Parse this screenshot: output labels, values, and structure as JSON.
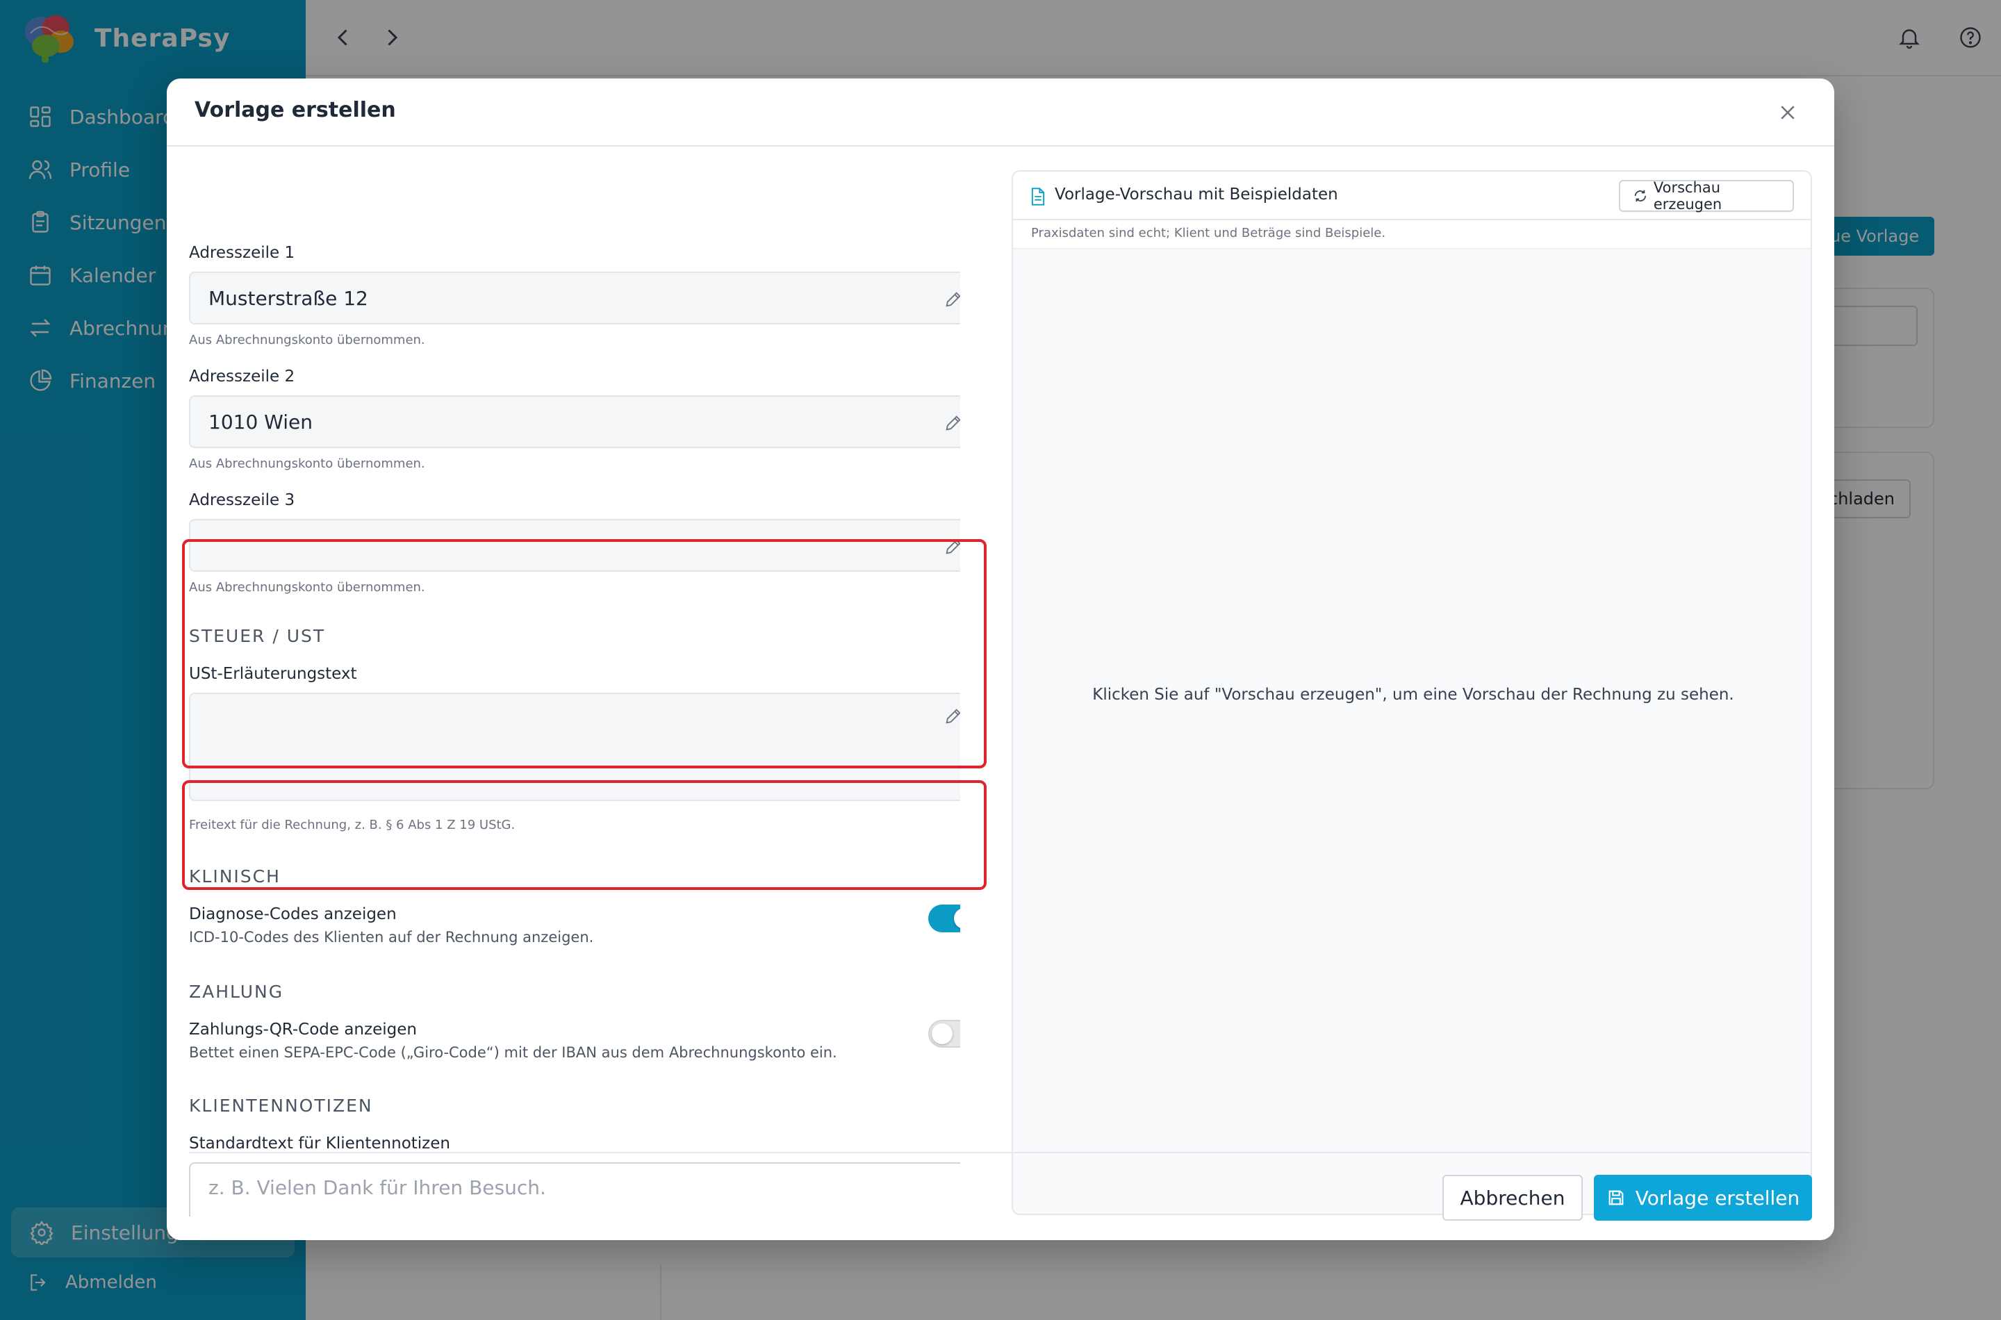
{
  "app": {
    "name": "TheraPsy"
  },
  "sidebar": {
    "items": [
      {
        "label": "Dashboard",
        "icon": "grid-icon"
      },
      {
        "label": "Profile",
        "icon": "users-icon"
      },
      {
        "label": "Sitzungen",
        "icon": "clipboard-icon"
      },
      {
        "label": "Kalender",
        "icon": "calendar-icon"
      },
      {
        "label": "Abrechnung",
        "icon": "swap-icon"
      },
      {
        "label": "Finanzen",
        "icon": "pie-chart-icon"
      }
    ],
    "settings": {
      "label": "Einstellungen",
      "icon": "gear-icon"
    },
    "logout": {
      "label": "Abmelden",
      "icon": "logout-icon"
    }
  },
  "background": {
    "new_template_label": "ue Vorlage",
    "download_label": "chladen"
  },
  "modal": {
    "title": "Vorlage erstellen",
    "fields": {
      "address1": {
        "label": "Adresszeile 1",
        "value": "Musterstraße 12",
        "help": "Aus Abrechnungskonto übernommen."
      },
      "address2": {
        "label": "Adresszeile 2",
        "value": "1010 Wien",
        "help": "Aus Abrechnungskonto übernommen."
      },
      "address3": {
        "label": "Adresszeile 3",
        "value": "",
        "help": "Aus Abrechnungskonto übernommen."
      }
    },
    "tax": {
      "heading": "STEUER / UST",
      "label": "USt-Erläuterungstext",
      "value": "",
      "help": "Freitext für die Rechnung, z. B. § 6 Abs 1 Z 19 UStG."
    },
    "clinical": {
      "heading": "KLINISCH",
      "toggle_title": "Diagnose-Codes anzeigen",
      "toggle_desc": "ICD-10-Codes des Klienten auf der Rechnung anzeigen.",
      "enabled": true
    },
    "payment": {
      "heading": "ZAHLUNG",
      "toggle_title": "Zahlungs-QR-Code anzeigen",
      "toggle_desc": "Bettet einen SEPA-EPC-Code („Giro-Code“) mit der IBAN aus dem Abrechnungskonto ein.",
      "enabled": false
    },
    "client_notes": {
      "heading": "KLIENTENNOTIZEN",
      "label": "Standardtext für Klientennotizen",
      "placeholder": "z. B. Vielen Dank für Ihren Besuch."
    },
    "preview": {
      "title": "Vorlage-Vorschau mit Beispieldaten",
      "button": "Vorschau erzeugen",
      "subtitle": "Praxisdaten sind echt; Klient und Beträge sind Beispiele.",
      "empty": "Klicken Sie auf \"Vorschau erzeugen\", um eine Vorschau der Rechnung zu sehen."
    },
    "footer": {
      "cancel": "Abbrechen",
      "create": "Vorlage erstellen"
    }
  },
  "colors": {
    "sidebar": "#0c9bc4",
    "primary_button": "#0ea5d8",
    "highlight": "#e0242b"
  }
}
